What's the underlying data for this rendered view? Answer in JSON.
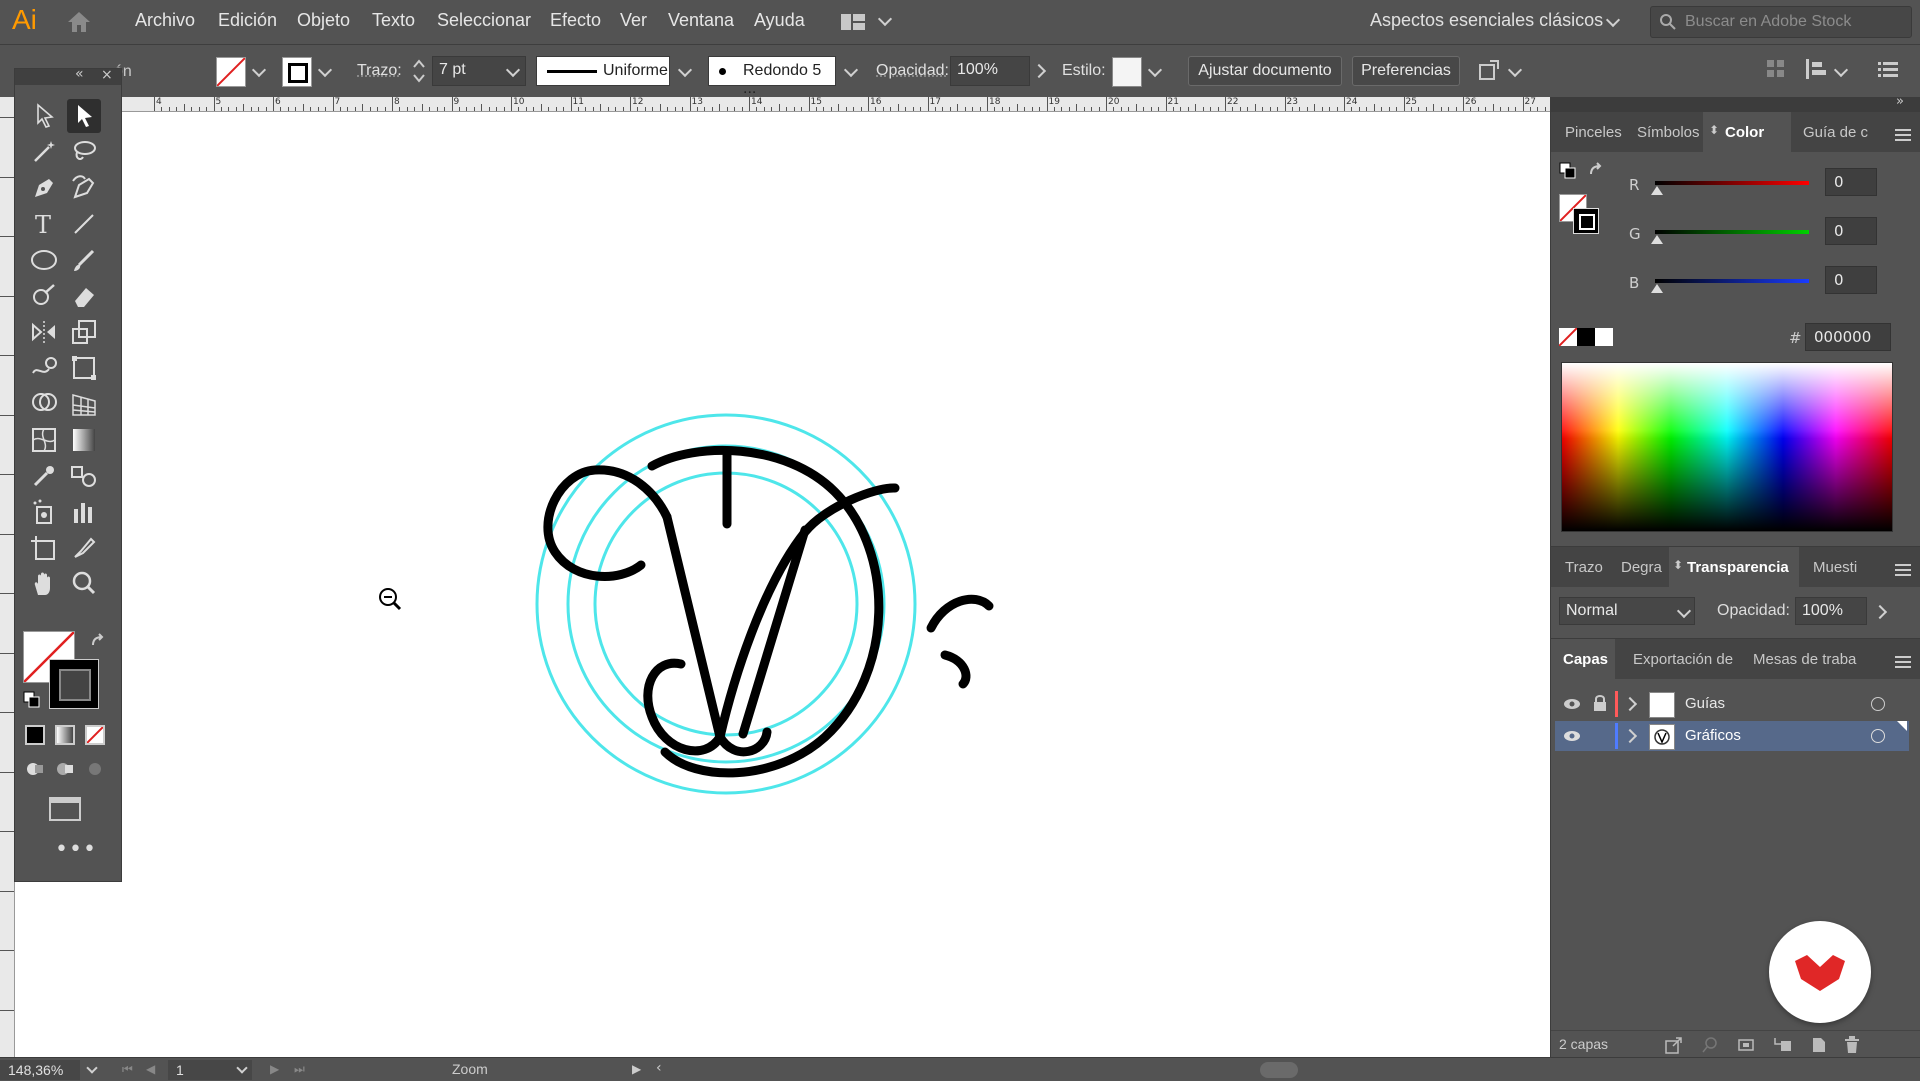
{
  "app": {
    "logo": "Ai"
  },
  "menu": [
    "Archivo",
    "Edición",
    "Objeto",
    "Texto",
    "Seleccionar",
    "Efecto",
    "Ver",
    "Ventana",
    "Ayuda"
  ],
  "workspace": {
    "name": "Aspectos esenciales clásicos"
  },
  "search": {
    "placeholder": "Buscar en Adobe Stock"
  },
  "control": {
    "selection_label": "ón",
    "stroke_label": "Trazo:",
    "stroke_weight": "7 pt",
    "profile": "Uniforme",
    "brush": "Redondo 5 ...",
    "opacity_label": "Opacidad:",
    "opacity_value": "100%",
    "style_label": "Estilo:",
    "fit_button": "Ajustar documento",
    "prefs_button": "Preferencias"
  },
  "ruler": {
    "ticks": [
      "4",
      "5",
      "6",
      "7",
      "8",
      "9",
      "10",
      "11",
      "12",
      "13",
      "14",
      "15",
      "16",
      "17",
      "18",
      "19",
      "20",
      "21",
      "22",
      "23",
      "24",
      "25",
      "26",
      "27"
    ]
  },
  "color_panel": {
    "tabs": [
      "Pinceles",
      "Símbolos",
      "Color",
      "Guía de c"
    ],
    "active_tab": "Color",
    "r_label": "R",
    "g_label": "G",
    "b_label": "B",
    "r": "0",
    "g": "0",
    "b": "0",
    "hex_label": "#",
    "hex": "000000"
  },
  "transparency_panel": {
    "tabs": [
      "Trazo",
      "Degra",
      "Transparencia",
      "Muesti"
    ],
    "active_tab": "Transparencia",
    "blend_mode": "Normal",
    "opacity_label": "Opacidad:",
    "opacity_value": "100%"
  },
  "layers_panel": {
    "tabs": [
      "Capas",
      "Exportación de",
      "Mesas de traba"
    ],
    "active_tab": "Capas",
    "layers": [
      {
        "name": "Guías",
        "color": "#ff5a5a",
        "locked": true,
        "selected": false
      },
      {
        "name": "Gráficos",
        "color": "#4f7cff",
        "locked": false,
        "selected": true
      }
    ],
    "count": "2 capas"
  },
  "status": {
    "zoom": "148,36%",
    "artboard": "1",
    "tool_name": "Zoom"
  },
  "colors": {
    "guide": "#4ee6ea",
    "stroke": "#000000",
    "selection_blue": "#56698a",
    "badge_red": "#e02727"
  }
}
